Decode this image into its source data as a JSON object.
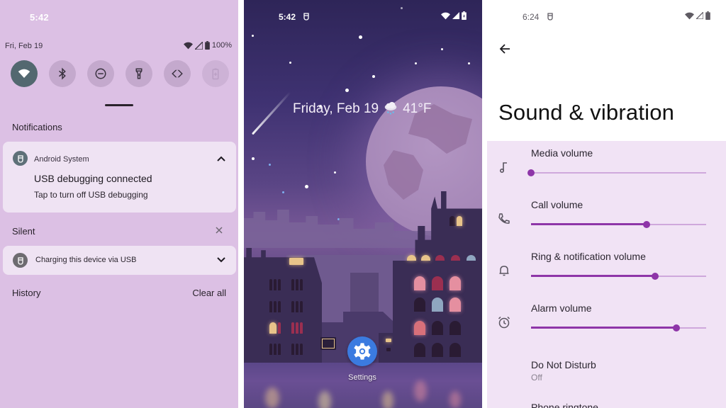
{
  "shade": {
    "status_time": "5:42",
    "date": "Fri, Feb 19",
    "battery_percent": "100%",
    "quick_tiles": [
      {
        "name": "wifi",
        "icon": "wifi-icon",
        "active": true
      },
      {
        "name": "bluetooth",
        "icon": "bluetooth-icon",
        "active": false
      },
      {
        "name": "do-not-disturb",
        "icon": "dnd-icon",
        "active": false
      },
      {
        "name": "flashlight",
        "icon": "flashlight-icon",
        "active": false
      },
      {
        "name": "auto-rotate",
        "icon": "rotate-icon",
        "active": false
      },
      {
        "name": "battery-saver",
        "icon": "battery-saver-icon",
        "active": false,
        "disabled": true
      }
    ],
    "notifications_header": "Notifications",
    "notification": {
      "app": "Android System",
      "title": "USB debugging connected",
      "text": "Tap to turn off USB debugging",
      "expanded": true
    },
    "silent_header": "Silent",
    "silent_notification": {
      "text": "Charging this device via USB",
      "expanded": false
    },
    "history_label": "History",
    "clear_all_label": "Clear all"
  },
  "home": {
    "status_time": "5:42",
    "glance_date": "Friday, Feb 19",
    "weather_icon": "rain-cloud-icon",
    "temperature": "41°F",
    "app": {
      "label": "Settings",
      "icon": "gear-icon",
      "color": "#3b7be0"
    }
  },
  "settings": {
    "status_time": "6:24",
    "title": "Sound & vibration",
    "accent": "#8e35a8",
    "volumes": [
      {
        "label": "Media volume",
        "icon": "music-note-icon",
        "value": 0.0
      },
      {
        "label": "Call volume",
        "icon": "phone-icon",
        "value": 0.66
      },
      {
        "label": "Ring & notification volume",
        "icon": "bell-icon",
        "value": 0.71
      },
      {
        "label": "Alarm volume",
        "icon": "alarm-icon",
        "value": 0.83
      }
    ],
    "dnd": {
      "label": "Do Not Disturb",
      "value": "Off"
    },
    "next_item_partial": "Phone ringtone"
  }
}
